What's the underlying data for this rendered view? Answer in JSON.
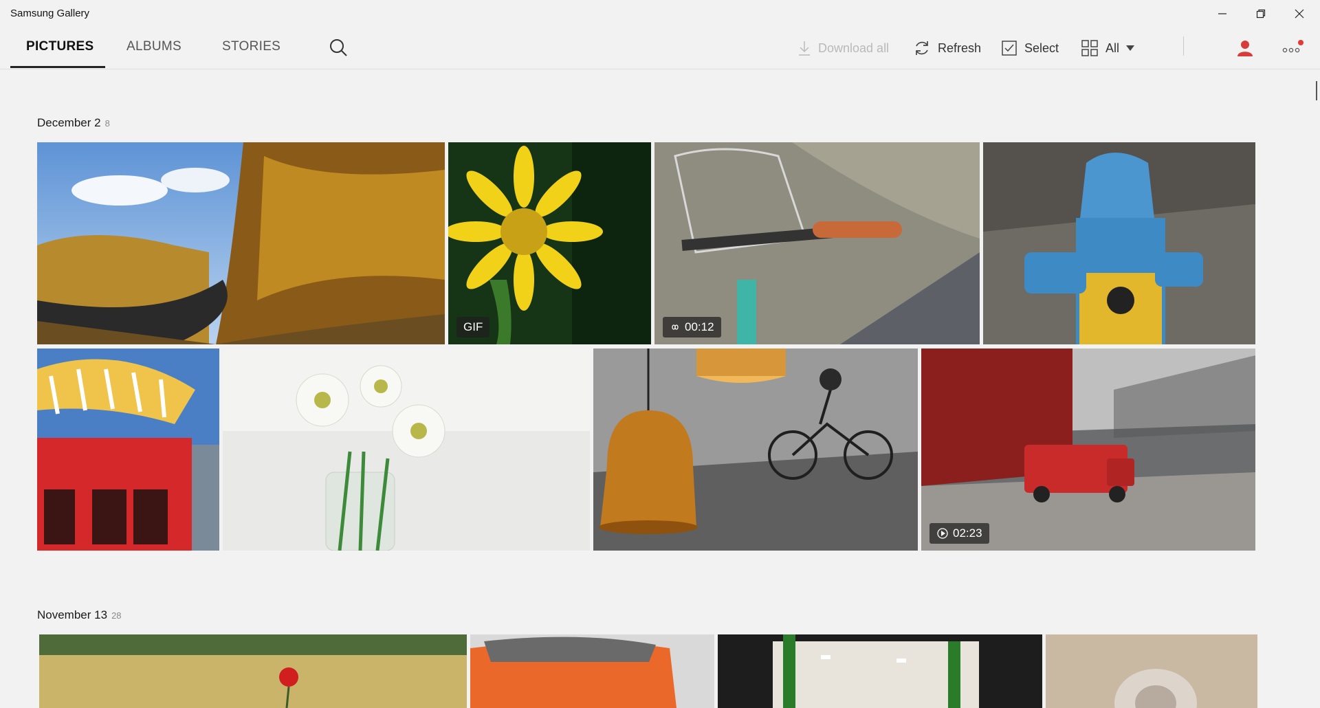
{
  "window": {
    "title": "Samsung Gallery"
  },
  "tabs": [
    {
      "label": "PICTURES",
      "active": true
    },
    {
      "label": "ALBUMS",
      "active": false
    },
    {
      "label": "STORIES",
      "active": false
    }
  ],
  "toolbar": {
    "download_all": "Download all",
    "refresh": "Refresh",
    "select": "Select",
    "view_filter": "All"
  },
  "sections": [
    {
      "date": "December 2",
      "count": "8",
      "items": [
        {
          "subject": "autumn road",
          "badge": ""
        },
        {
          "subject": "yellow flower",
          "badge": "GIF"
        },
        {
          "subject": "bicycle handlebar",
          "badge": "00:12"
        },
        {
          "subject": "fire hydrant",
          "badge": ""
        },
        {
          "subject": "red bus with umbrella",
          "badge": ""
        },
        {
          "subject": "white flowers in jar",
          "badge": ""
        },
        {
          "subject": "lamp and cyclist",
          "badge": ""
        },
        {
          "subject": "red van",
          "badge": "02:23"
        }
      ]
    },
    {
      "date": "November 13",
      "count": "28",
      "items": [
        {
          "subject": "poppy field"
        },
        {
          "subject": "orange car"
        },
        {
          "subject": "green doorway"
        },
        {
          "subject": "seashell"
        }
      ]
    }
  ],
  "colors": {
    "accent": "#d83b3b",
    "background": "#f2f2f2"
  }
}
